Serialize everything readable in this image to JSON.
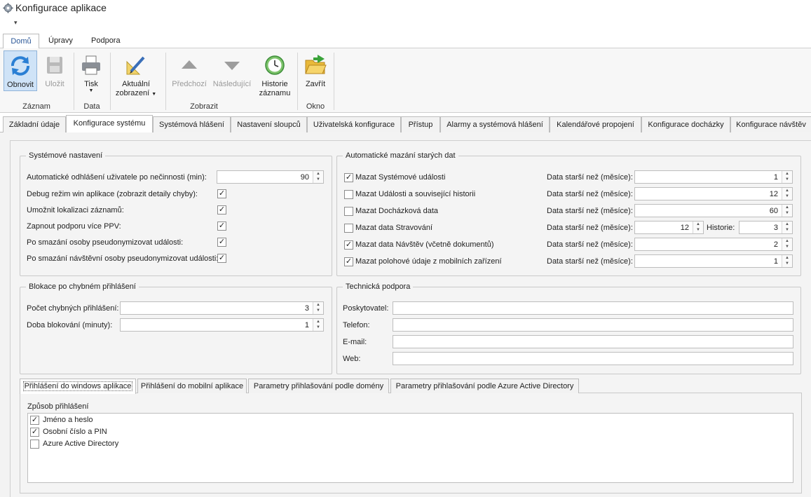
{
  "window": {
    "title": "Konfigurace aplikace",
    "qat_symbol": "▾"
  },
  "ribbon": {
    "tabs": [
      "Domů",
      "Úpravy",
      "Podpora"
    ],
    "buttons": {
      "refresh": "Obnovit",
      "save": "Uložit",
      "print": "Tisk",
      "current_view_1": "Aktuální",
      "current_view_2": "zobrazení",
      "previous": "Předchozí",
      "next": "Následující",
      "history_1": "Historie",
      "history_2": "záznamu",
      "close": "Zavřít"
    },
    "groups": {
      "record": "Záznam",
      "data": "Data",
      "view": "Zobrazit",
      "window": "Okno"
    }
  },
  "main_tabs": [
    "Základní údaje",
    "Konfigurace systému",
    "Systémová hlášení",
    "Nastavení sloupců",
    "Uživatelská konfigurace",
    "Přístup",
    "Alarmy a systémová hlášení",
    "Kalendářové propojení",
    "Konfigurace docházky",
    "Konfigurace návštěv"
  ],
  "system_settings": {
    "title": "Systémové nastavení",
    "auto_logout_label": "Automatické odhlášení uživatele po nečinnosti (min):",
    "auto_logout_value": "90",
    "debug_label": "Debug režim win aplikace (zobrazit detaily chyby):",
    "localization_label": "Umožnit lokalizaci záznamů:",
    "multi_ppv_label": "Zapnout podporu více PPV:",
    "pseudo_person_label": "Po smazání osoby pseudonymizovat události:",
    "pseudo_visitor_label": "Po smazání návštěvní osoby pseudonymizovat události:",
    "check_mark": "✓"
  },
  "auto_delete": {
    "title": "Automatické mazání starých dat",
    "older_than": "Data starší než (měsíce):",
    "history_label": "Historie:",
    "rows": [
      {
        "label": "Mazat Systémové události",
        "checked": true,
        "value": "1"
      },
      {
        "label": "Mazat Události a související historii",
        "checked": false,
        "value": "12"
      },
      {
        "label": "Mazat Docházková data",
        "checked": false,
        "value": "60"
      },
      {
        "label": "Mazat data Stravování",
        "checked": false,
        "value": "12",
        "history": "3"
      },
      {
        "label": "Mazat data Návštěv (včetně dokumentů)",
        "checked": true,
        "value": "2"
      },
      {
        "label": "Mazat polohové údaje z mobilních zařízení",
        "checked": true,
        "value": "1"
      }
    ]
  },
  "lockout": {
    "title": "Blokace po chybném přihlášení",
    "attempts_label": "Počet chybných přihlášení:",
    "attempts_value": "3",
    "duration_label": "Doba blokování (minuty):",
    "duration_value": "1"
  },
  "support": {
    "title": "Technická podpora",
    "provider_label": "Poskytovatel:",
    "phone_label": "Telefon:",
    "email_label": "E-mail:",
    "web_label": "Web:"
  },
  "login_tabs": [
    "Přihlášení do windows aplikace",
    "Přihlášení do mobilní aplikace",
    "Parametry přihlašování podle domény",
    "Parametry přihlašování podle Azure Active Directory"
  ],
  "login": {
    "method_label": "Způsob přihlášení",
    "methods": [
      {
        "label": "Jméno a heslo",
        "checked": true
      },
      {
        "label": "Osobní číslo a PIN",
        "checked": true
      },
      {
        "label": "Azure Active Directory",
        "checked": false
      }
    ]
  },
  "spinner_arrows": {
    "up": "▲",
    "down": "▼"
  }
}
